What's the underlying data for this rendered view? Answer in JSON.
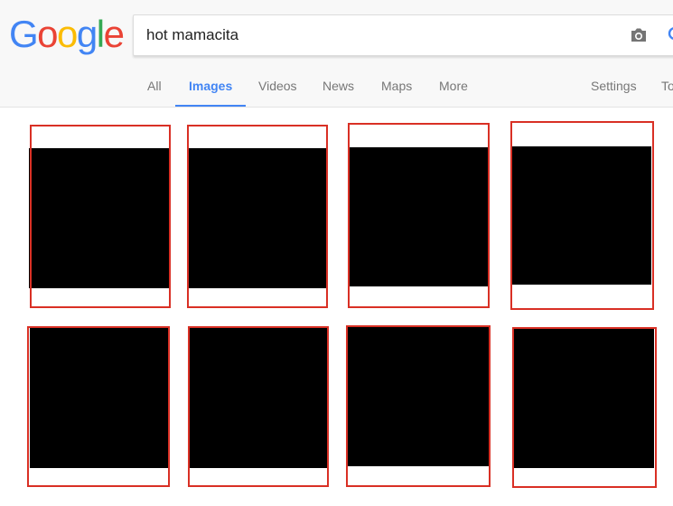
{
  "logo": {
    "letters": [
      "G",
      "o",
      "o",
      "g",
      "l",
      "e"
    ],
    "colors": [
      "#4285F4",
      "#EA4335",
      "#FBBC05",
      "#4285F4",
      "#34A853",
      "#EA4335"
    ]
  },
  "search": {
    "query": "hot mamacita",
    "camera_icon": "camera-icon",
    "search_icon": "magnifier-icon"
  },
  "tabs": {
    "all": "All",
    "images": "Images",
    "videos": "Videos",
    "news": "News",
    "maps": "Maps",
    "more": "More",
    "settings": "Settings",
    "tools": "Tools",
    "active": "images"
  },
  "colors": {
    "accent": "#4285f4",
    "annotation_red": "#d93025",
    "thumbnail": "#000000"
  },
  "results": {
    "count_visible": 8
  }
}
